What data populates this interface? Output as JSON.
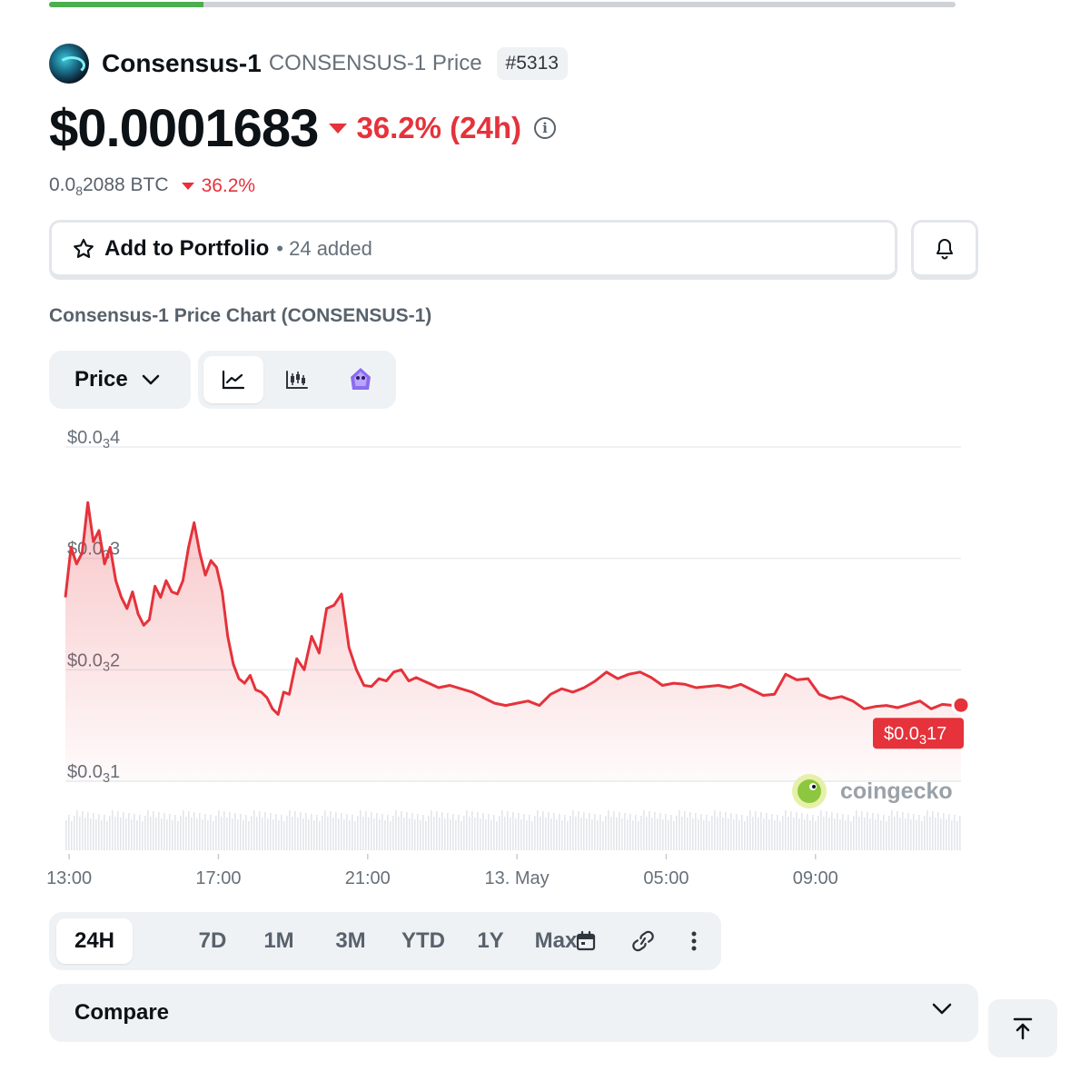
{
  "loading_progress": 0.17,
  "coin": {
    "name": "Consensus-1",
    "subtitle": "CONSENSUS-1 Price",
    "rank": "#5313",
    "logo_icon": "coin-logo"
  },
  "price": {
    "value": "$0.0001683",
    "change": "36.2% (24h)",
    "direction": "down"
  },
  "btc": {
    "prefix": "0.0",
    "subscript": "8",
    "suffix": "2088 BTC",
    "change": "36.2%"
  },
  "portfolio": {
    "label": "Add to Portfolio",
    "count": "• 24 added"
  },
  "chart_title": "Consensus-1 Price Chart (CONSENSUS-1)",
  "controls": {
    "metric": "Price",
    "chart_types": [
      "line-chart-icon",
      "candlestick-icon",
      "tradingview-icon"
    ],
    "active_chart_type": 0
  },
  "ranges": {
    "items": [
      "24H",
      "7D",
      "1M",
      "3M",
      "YTD",
      "1Y",
      "Max"
    ],
    "active": "24H"
  },
  "compare_label": "Compare",
  "colors": {
    "down": "#e5323b",
    "up": "#4cae4f",
    "line": "#e5323b"
  },
  "chart_data": {
    "type": "area",
    "title": "",
    "xlabel": "",
    "ylabel": "",
    "y_ticks": [
      {
        "value": 0.0001,
        "prefix": "$0.0",
        "sub": "3",
        "suffix": "1"
      },
      {
        "value": 0.0002,
        "prefix": "$0.0",
        "sub": "3",
        "suffix": "2"
      },
      {
        "value": 0.0003,
        "prefix": "$0.0",
        "sub": "3",
        "suffix": "3"
      },
      {
        "value": 0.0004,
        "prefix": "$0.0",
        "sub": "3",
        "suffix": "4"
      }
    ],
    "ylim": [
      0.0001,
      0.0004
    ],
    "x_ticks": [
      {
        "hour": 0.1,
        "label": "13:00"
      },
      {
        "hour": 4.1,
        "label": "17:00"
      },
      {
        "hour": 8.1,
        "label": "21:00"
      },
      {
        "hour": 12.1,
        "label": "13. May"
      },
      {
        "hour": 16.1,
        "label": "05:00"
      },
      {
        "hour": 20.1,
        "label": "09:00"
      }
    ],
    "xlim": [
      0,
      24
    ],
    "current_label": {
      "prefix": "$0.0",
      "sub": "3",
      "suffix": "17"
    },
    "watermark": "coingecko",
    "series": [
      {
        "x": [
          0,
          0.15,
          0.3,
          0.45,
          0.6,
          0.75,
          0.9,
          1.05,
          1.2,
          1.35,
          1.5,
          1.65,
          1.8,
          1.95,
          2.1,
          2.25,
          2.4,
          2.55,
          2.7,
          2.85,
          3.0,
          3.15,
          3.3,
          3.45,
          3.6,
          3.75,
          3.9,
          4.05,
          4.2,
          4.35,
          4.5,
          4.65,
          4.8,
          4.95,
          5.1,
          5.25,
          5.4,
          5.55,
          5.7,
          5.85,
          6.0,
          6.2,
          6.4,
          6.6,
          6.8,
          7.0,
          7.2,
          7.4,
          7.6,
          7.8,
          8.0,
          8.2,
          8.4,
          8.6,
          8.8,
          9.0,
          9.2,
          9.4,
          9.6,
          9.8,
          10.0,
          10.3,
          10.6,
          10.9,
          11.2,
          11.5,
          11.8,
          12.1,
          12.4,
          12.7,
          13.0,
          13.3,
          13.6,
          13.9,
          14.2,
          14.5,
          14.8,
          15.1,
          15.4,
          15.7,
          16.0,
          16.3,
          16.6,
          16.9,
          17.2,
          17.5,
          17.8,
          18.1,
          18.4,
          18.7,
          19.0,
          19.3,
          19.6,
          19.9,
          20.2,
          20.5,
          20.8,
          21.1,
          21.4,
          21.7,
          22.0,
          22.3,
          22.6,
          22.9,
          23.2,
          23.5,
          23.8,
          24.0
        ],
        "values": [
          0.000265,
          0.00031,
          0.000295,
          0.000305,
          0.00035,
          0.000315,
          0.000325,
          0.000295,
          0.00031,
          0.00028,
          0.000265,
          0.000255,
          0.00027,
          0.00025,
          0.00024,
          0.000245,
          0.000275,
          0.000265,
          0.00028,
          0.00027,
          0.000268,
          0.00028,
          0.00031,
          0.000332,
          0.000305,
          0.000285,
          0.000298,
          0.000292,
          0.00027,
          0.00023,
          0.000205,
          0.000192,
          0.000188,
          0.000195,
          0.000182,
          0.00018,
          0.000175,
          0.000165,
          0.00016,
          0.00018,
          0.000178,
          0.00021,
          0.0002,
          0.00023,
          0.000215,
          0.000255,
          0.000258,
          0.000268,
          0.00022,
          0.0002,
          0.000186,
          0.000185,
          0.000192,
          0.00019,
          0.000198,
          0.0002,
          0.00019,
          0.000193,
          0.00019,
          0.000187,
          0.000184,
          0.000186,
          0.000183,
          0.00018,
          0.000175,
          0.00017,
          0.000168,
          0.00017,
          0.000172,
          0.000168,
          0.000178,
          0.000183,
          0.00018,
          0.000184,
          0.00019,
          0.000198,
          0.000192,
          0.000196,
          0.000198,
          0.000193,
          0.000186,
          0.000188,
          0.000187,
          0.000184,
          0.000185,
          0.000186,
          0.000184,
          0.000187,
          0.000182,
          0.000177,
          0.000178,
          0.000196,
          0.000191,
          0.000192,
          0.000178,
          0.000174,
          0.000176,
          0.000172,
          0.000165,
          0.000167,
          0.000168,
          0.000166,
          0.000169,
          0.000172,
          0.000165,
          0.000169,
          0.000168,
          0.0001683
        ]
      }
    ],
    "volume_shown": true,
    "grid": true,
    "legend": "none"
  }
}
